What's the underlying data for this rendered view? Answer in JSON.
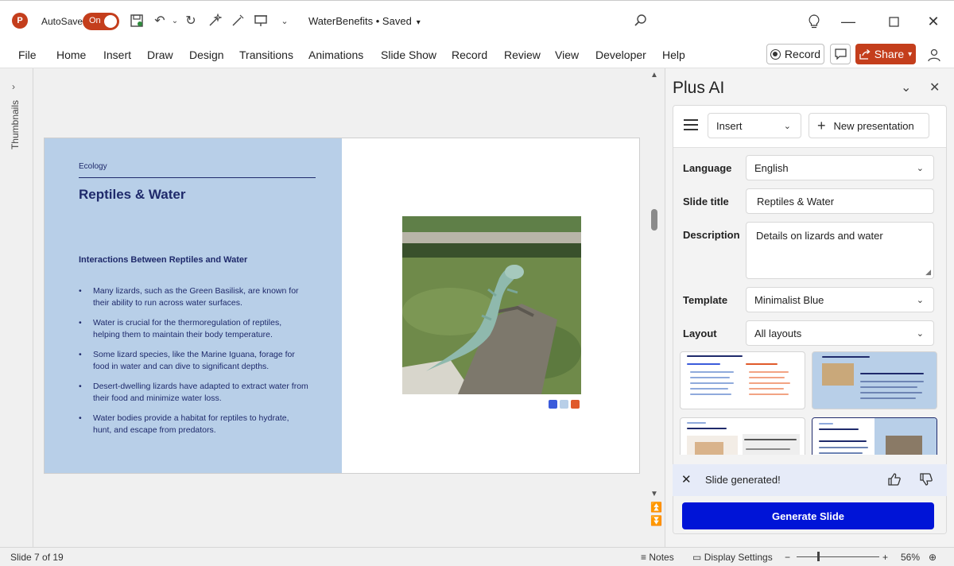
{
  "titlebar": {
    "autosave_label": "AutoSave",
    "autosave_state": "On",
    "doc_title": "WaterBenefits • Saved"
  },
  "ribbon": {
    "tabs": [
      "File",
      "Home",
      "Insert",
      "Draw",
      "Design",
      "Transitions",
      "Animations",
      "Slide Show",
      "Record",
      "Review",
      "View",
      "Developer",
      "Help"
    ],
    "record_label": "Record",
    "share_label": "Share"
  },
  "thumbnails": {
    "label": "Thumbnails"
  },
  "slide": {
    "category": "Ecology",
    "title": "Reptiles & Water",
    "subtitle": "Interactions Between Reptiles and Water",
    "bullets": [
      "Many lizards, such as the Green Basilisk, are known for their ability to run across water surfaces.",
      "Water is crucial for the thermoregulation of reptiles, helping them to maintain their body temperature.",
      "Some lizard species, like the Marine Iguana, forage for food in water and can dive to significant depths.",
      "Desert-dwelling lizards have adapted to extract water from their food and minimize water loss.",
      "Water bodies provide a habitat for reptiles to hydrate, hunt, and escape from predators."
    ],
    "accent_colors": [
      "#3b5bdb",
      "#b8cfe8",
      "#e05a2b"
    ]
  },
  "panel": {
    "title": "Plus AI",
    "insert_select": "Insert",
    "new_presentation_label": "New presentation",
    "fields": {
      "language_label": "Language",
      "language_value": "English",
      "slide_title_label": "Slide title",
      "slide_title_value": "Reptiles & Water",
      "description_label": "Description",
      "description_value": "Details on lizards and water",
      "template_label": "Template",
      "template_value": "Minimalist Blue",
      "layout_label": "Layout",
      "layout_value": "All layouts"
    },
    "generated_message": "Slide generated!",
    "generate_button": "Generate Slide"
  },
  "statusbar": {
    "slide_indicator": "Slide 7 of 19",
    "notes_label": "Notes",
    "display_settings_label": "Display Settings",
    "zoom_level": "56%"
  },
  "colors": {
    "brand": "#c43e1c",
    "slide_panel": "#b8cfe8",
    "slide_text": "#1f2a6b",
    "generate_button": "#0014d7"
  }
}
